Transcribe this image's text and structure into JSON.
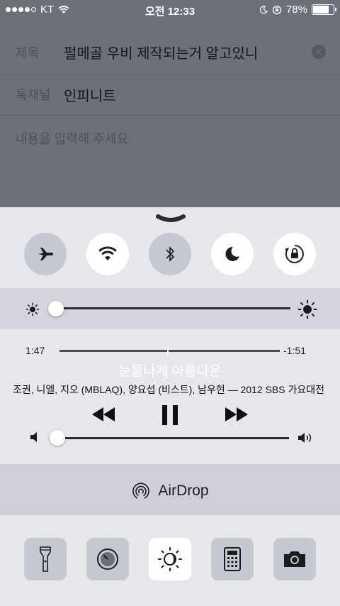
{
  "status_bar": {
    "carrier": "KT",
    "time": "오전 12:33",
    "battery_percent": "78%",
    "battery_level": 0.78
  },
  "compose": {
    "subject_label": "제목",
    "subject_value": "펄메골 우비 제작되는거 알고있니",
    "board_label": "톡채널",
    "board_value": "인피니트",
    "body_placeholder": "내용을 입력해 주세요."
  },
  "control_center": {
    "toggles": [
      {
        "name": "airplane-mode",
        "icon": "airplane-icon",
        "on": false
      },
      {
        "name": "wifi",
        "icon": "wifi-icon",
        "on": true
      },
      {
        "name": "bluetooth",
        "icon": "bluetooth-icon",
        "on": false
      },
      {
        "name": "do-not-disturb",
        "icon": "moon-icon",
        "on": true
      },
      {
        "name": "rotation-lock",
        "icon": "rotation-lock-icon",
        "on": true
      }
    ],
    "brightness_level": 0.0,
    "music": {
      "elapsed": "1:47",
      "remaining": "-1:51",
      "progress": 0.49,
      "title": "눈물나게 아름다운",
      "artist_album": "조권, 니엘, 지오 (MBLAQ), 양요섭 (비스트), 남우현 — 2012 SBS 가요대전",
      "volume_level": 0.0
    },
    "airdrop_label": "AirDrop",
    "tools": [
      {
        "name": "flashlight",
        "icon": "flashlight-icon",
        "on": false
      },
      {
        "name": "timer",
        "icon": "timer-icon",
        "on": false
      },
      {
        "name": "night-shift",
        "icon": "night-shift-icon",
        "on": true
      },
      {
        "name": "calculator",
        "icon": "calculator-icon",
        "on": false
      },
      {
        "name": "camera",
        "icon": "camera-icon",
        "on": false
      }
    ]
  }
}
